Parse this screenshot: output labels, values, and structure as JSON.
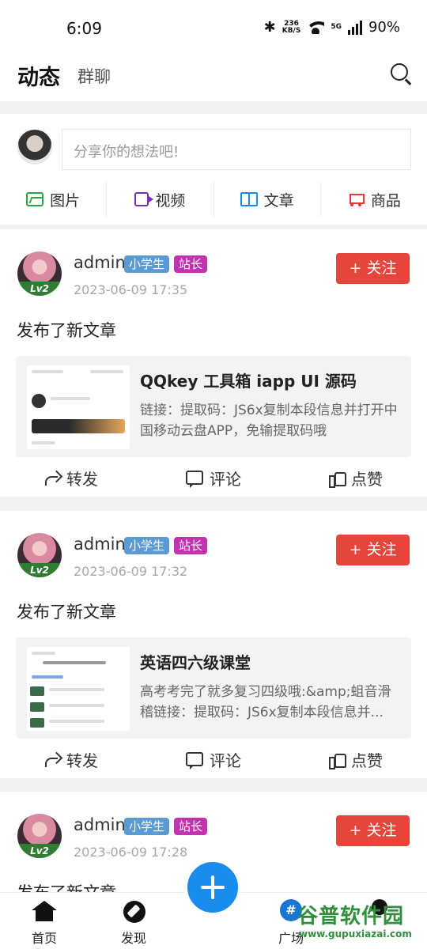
{
  "status_bar": {
    "time": "6:09",
    "speed_value": "236",
    "speed_unit": "KB/S",
    "signal": "5G",
    "battery": "90%"
  },
  "header": {
    "active_tab": "动态",
    "inactive_tab": "群聊"
  },
  "composer": {
    "placeholder": "分享你的想法吧!",
    "actions": [
      {
        "label": "图片",
        "icon": "image-icon",
        "color": "#28a745"
      },
      {
        "label": "视频",
        "icon": "video-icon",
        "color": "#7b2cbf"
      },
      {
        "label": "文章",
        "icon": "article-icon",
        "color": "#1e88e5"
      },
      {
        "label": "商品",
        "icon": "cart-icon",
        "color": "#e53935"
      }
    ]
  },
  "posts": [
    {
      "author": "admin",
      "level": "Lv2",
      "badges": [
        "小学生",
        "站长"
      ],
      "time": "2023-06-09 17:35",
      "follow_label": "+ 关注",
      "action_text": "发布了新文章",
      "article": {
        "title": "QQkey 工具箱 iapp UI 源码",
        "excerpt": "链接：提取码：JS6x复制本段信息并打开中国移动云盘APP，免输提取码哦"
      },
      "footer": {
        "share": "转发",
        "comment": "评论",
        "like": "点赞"
      }
    },
    {
      "author": "admin",
      "level": "Lv2",
      "badges": [
        "小学生",
        "站长"
      ],
      "time": "2023-06-09 17:32",
      "follow_label": "+ 关注",
      "action_text": "发布了新文章",
      "article": {
        "title": "英语四六级课堂",
        "excerpt": "高考考完了就多复习四级哦:&amp;蛆音滑稽链接：提取码：JS6x复制本段信息并..."
      },
      "footer": {
        "share": "转发",
        "comment": "评论",
        "like": "点赞"
      }
    },
    {
      "author": "admin",
      "level": "Lv2",
      "badges": [
        "小学生",
        "站长"
      ],
      "time": "2023-06-09 17:28",
      "follow_label": "+ 关注",
      "action_text": "发布了新文章"
    }
  ],
  "bottom_nav": {
    "home": "首页",
    "discover": "发现",
    "plaza": "广场",
    "plaza_glyph": "#"
  },
  "watermark": {
    "main": "谷普软件园",
    "sub": "www.gupuxiazai.com"
  },
  "colors": {
    "accent": "#1a8cf0",
    "follow": "#e5453a",
    "badge_student": "#5b9bd5",
    "badge_admin": "#c233b0"
  }
}
